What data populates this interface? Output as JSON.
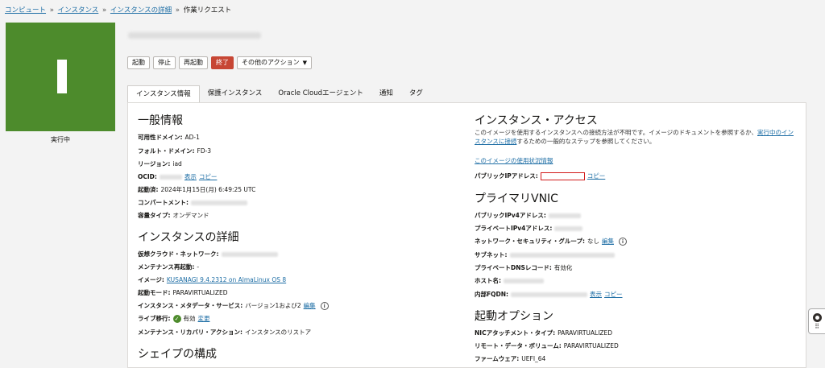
{
  "breadcrumb": {
    "items": [
      "コンピュート",
      "インスタンス",
      "インスタンスの詳細"
    ],
    "separator": "»",
    "current": "作業リクエスト"
  },
  "instance": {
    "state": "実行中",
    "tile_color": "#4d8b2c"
  },
  "actions": {
    "start": "起動",
    "stop": "停止",
    "reboot": "再起動",
    "terminate": "終了",
    "more": "その他のアクション"
  },
  "tabs": [
    "インスタンス情報",
    "保護インスタンス",
    "Oracle Cloudエージェント",
    "通知",
    "タグ"
  ],
  "general": {
    "heading": "一般情報",
    "ad_label": "可用性ドメイン:",
    "ad_value": "AD-1",
    "fd_label": "フォルト・ドメイン:",
    "fd_value": "FD-3",
    "region_label": "リージョン:",
    "region_value": "iad",
    "ocid_label": "OCID:",
    "show": "表示",
    "copy": "コピー",
    "launched_label": "起動済:",
    "launched_value": "2024年1月15日(月) 6:49:25 UTC",
    "compartment_label": "コンパートメント:",
    "capacity_label": "容量タイプ:",
    "capacity_value": "オンデマンド"
  },
  "details": {
    "heading": "インスタンスの詳細",
    "vcn_label": "仮想クラウド・ネットワーク:",
    "maint_label": "メンテナンス再起動:",
    "maint_value": "-",
    "image_label": "イメージ:",
    "image_value": "KUSANAGI 9.4.2312 on AlmaLinux OS 8",
    "launch_mode_label": "起動モード:",
    "launch_mode_value": "PARAVIRTUALIZED",
    "metadata_label": "インスタンス・メタデータ・サービス:",
    "metadata_value": "バージョン1および2",
    "edit": "編集",
    "live_label": "ライブ移行:",
    "live_value": "有効",
    "change": "変更",
    "recovery_label": "メンテナンス・リカバリ・アクション:",
    "recovery_value": "インスタンスのリストア"
  },
  "shape": {
    "heading": "シェイプの構成"
  },
  "access": {
    "heading": "インスタンス・アクセス",
    "desc_1": "このイメージを使用するインスタンスへの接続方法が不明です。イメージのドキュメントを参照するか、",
    "desc_link": "実行中のインスタンスに接続",
    "desc_2": "するための一般的なステップを参照してください。",
    "usage_link": "このイメージの使用状況情報",
    "public_ip_label": "パブリックIPアドレス:",
    "copy": "コピー"
  },
  "vnic": {
    "heading": "プライマリVNIC",
    "public_ipv4_label": "パブリックIPv4アドレス:",
    "private_ipv4_label": "プライベートIPv4アドレス:",
    "nsg_label": "ネットワーク・セキュリティ・グループ:",
    "nsg_value": "なし",
    "edit": "編集",
    "subnet_label": "サブネット:",
    "dns_label": "プライベートDNSレコード:",
    "dns_value": "有効化",
    "hostname_label": "ホスト名:",
    "fqdn_label": "内部FQDN:",
    "show": "表示",
    "copy": "コピー"
  },
  "launch_options": {
    "heading": "起動オプション",
    "nic_label": "NICアタッチメント・タイプ:",
    "nic_value": "PARAVIRTUALIZED",
    "volume_label": "リモート・データ・ボリューム:",
    "volume_value": "PARAVIRTUALIZED",
    "firmware_label": "ファームウェア:",
    "firmware_value": "UEFI_64"
  }
}
